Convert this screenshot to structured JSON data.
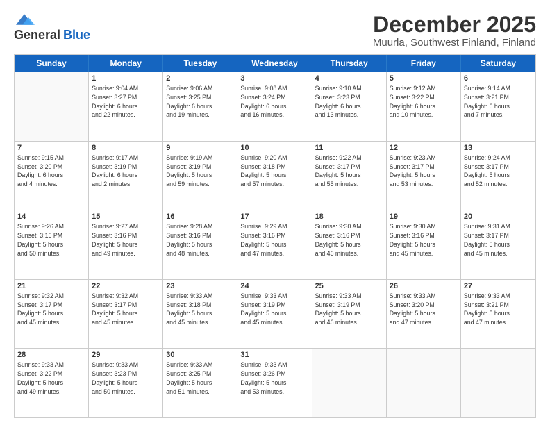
{
  "header": {
    "logo_general": "General",
    "logo_blue": "Blue",
    "title": "December 2025",
    "subtitle": "Muurla, Southwest Finland, Finland"
  },
  "weekdays": [
    "Sunday",
    "Monday",
    "Tuesday",
    "Wednesday",
    "Thursday",
    "Friday",
    "Saturday"
  ],
  "rows": [
    [
      {
        "day": "",
        "info": ""
      },
      {
        "day": "1",
        "info": "Sunrise: 9:04 AM\nSunset: 3:27 PM\nDaylight: 6 hours\nand 22 minutes."
      },
      {
        "day": "2",
        "info": "Sunrise: 9:06 AM\nSunset: 3:25 PM\nDaylight: 6 hours\nand 19 minutes."
      },
      {
        "day": "3",
        "info": "Sunrise: 9:08 AM\nSunset: 3:24 PM\nDaylight: 6 hours\nand 16 minutes."
      },
      {
        "day": "4",
        "info": "Sunrise: 9:10 AM\nSunset: 3:23 PM\nDaylight: 6 hours\nand 13 minutes."
      },
      {
        "day": "5",
        "info": "Sunrise: 9:12 AM\nSunset: 3:22 PM\nDaylight: 6 hours\nand 10 minutes."
      },
      {
        "day": "6",
        "info": "Sunrise: 9:14 AM\nSunset: 3:21 PM\nDaylight: 6 hours\nand 7 minutes."
      }
    ],
    [
      {
        "day": "7",
        "info": "Sunrise: 9:15 AM\nSunset: 3:20 PM\nDaylight: 6 hours\nand 4 minutes."
      },
      {
        "day": "8",
        "info": "Sunrise: 9:17 AM\nSunset: 3:19 PM\nDaylight: 6 hours\nand 2 minutes."
      },
      {
        "day": "9",
        "info": "Sunrise: 9:19 AM\nSunset: 3:19 PM\nDaylight: 5 hours\nand 59 minutes."
      },
      {
        "day": "10",
        "info": "Sunrise: 9:20 AM\nSunset: 3:18 PM\nDaylight: 5 hours\nand 57 minutes."
      },
      {
        "day": "11",
        "info": "Sunrise: 9:22 AM\nSunset: 3:17 PM\nDaylight: 5 hours\nand 55 minutes."
      },
      {
        "day": "12",
        "info": "Sunrise: 9:23 AM\nSunset: 3:17 PM\nDaylight: 5 hours\nand 53 minutes."
      },
      {
        "day": "13",
        "info": "Sunrise: 9:24 AM\nSunset: 3:17 PM\nDaylight: 5 hours\nand 52 minutes."
      }
    ],
    [
      {
        "day": "14",
        "info": "Sunrise: 9:26 AM\nSunset: 3:16 PM\nDaylight: 5 hours\nand 50 minutes."
      },
      {
        "day": "15",
        "info": "Sunrise: 9:27 AM\nSunset: 3:16 PM\nDaylight: 5 hours\nand 49 minutes."
      },
      {
        "day": "16",
        "info": "Sunrise: 9:28 AM\nSunset: 3:16 PM\nDaylight: 5 hours\nand 48 minutes."
      },
      {
        "day": "17",
        "info": "Sunrise: 9:29 AM\nSunset: 3:16 PM\nDaylight: 5 hours\nand 47 minutes."
      },
      {
        "day": "18",
        "info": "Sunrise: 9:30 AM\nSunset: 3:16 PM\nDaylight: 5 hours\nand 46 minutes."
      },
      {
        "day": "19",
        "info": "Sunrise: 9:30 AM\nSunset: 3:16 PM\nDaylight: 5 hours\nand 45 minutes."
      },
      {
        "day": "20",
        "info": "Sunrise: 9:31 AM\nSunset: 3:17 PM\nDaylight: 5 hours\nand 45 minutes."
      }
    ],
    [
      {
        "day": "21",
        "info": "Sunrise: 9:32 AM\nSunset: 3:17 PM\nDaylight: 5 hours\nand 45 minutes."
      },
      {
        "day": "22",
        "info": "Sunrise: 9:32 AM\nSunset: 3:17 PM\nDaylight: 5 hours\nand 45 minutes."
      },
      {
        "day": "23",
        "info": "Sunrise: 9:33 AM\nSunset: 3:18 PM\nDaylight: 5 hours\nand 45 minutes."
      },
      {
        "day": "24",
        "info": "Sunrise: 9:33 AM\nSunset: 3:19 PM\nDaylight: 5 hours\nand 45 minutes."
      },
      {
        "day": "25",
        "info": "Sunrise: 9:33 AM\nSunset: 3:19 PM\nDaylight: 5 hours\nand 46 minutes."
      },
      {
        "day": "26",
        "info": "Sunrise: 9:33 AM\nSunset: 3:20 PM\nDaylight: 5 hours\nand 47 minutes."
      },
      {
        "day": "27",
        "info": "Sunrise: 9:33 AM\nSunset: 3:21 PM\nDaylight: 5 hours\nand 47 minutes."
      }
    ],
    [
      {
        "day": "28",
        "info": "Sunrise: 9:33 AM\nSunset: 3:22 PM\nDaylight: 5 hours\nand 49 minutes."
      },
      {
        "day": "29",
        "info": "Sunrise: 9:33 AM\nSunset: 3:23 PM\nDaylight: 5 hours\nand 50 minutes."
      },
      {
        "day": "30",
        "info": "Sunrise: 9:33 AM\nSunset: 3:25 PM\nDaylight: 5 hours\nand 51 minutes."
      },
      {
        "day": "31",
        "info": "Sunrise: 9:33 AM\nSunset: 3:26 PM\nDaylight: 5 hours\nand 53 minutes."
      },
      {
        "day": "",
        "info": ""
      },
      {
        "day": "",
        "info": ""
      },
      {
        "day": "",
        "info": ""
      }
    ]
  ]
}
